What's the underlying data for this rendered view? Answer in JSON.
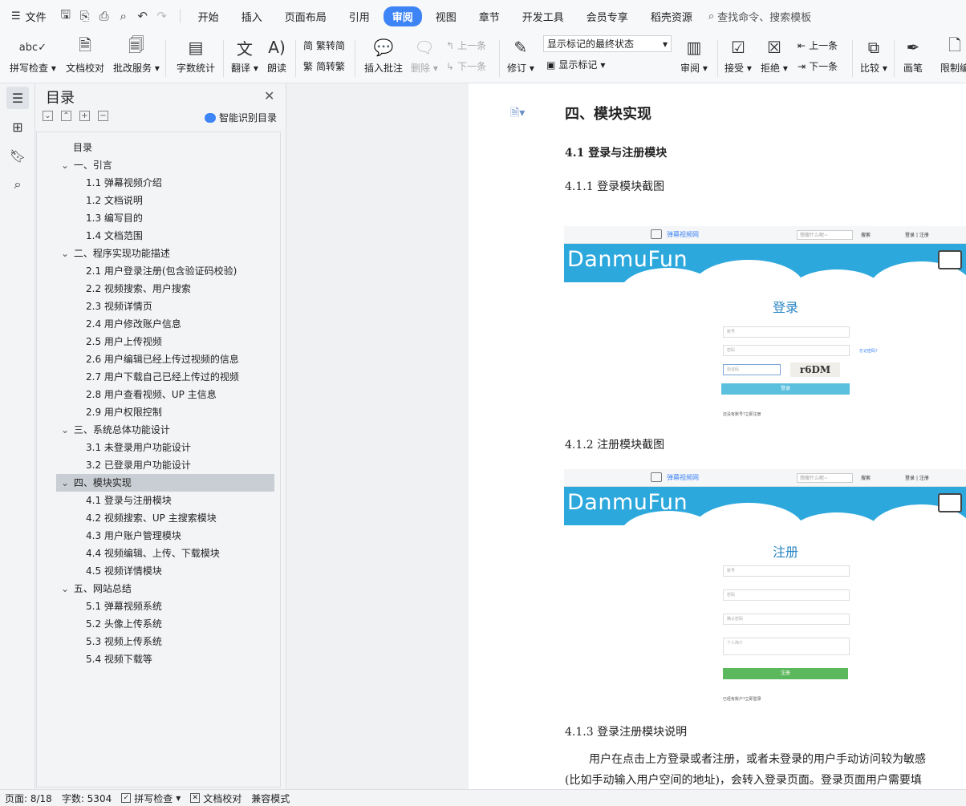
{
  "menubar": {
    "file_label": "文件",
    "tabs": [
      {
        "label": "开始",
        "active": false
      },
      {
        "label": "插入",
        "active": false
      },
      {
        "label": "页面布局",
        "active": false
      },
      {
        "label": "引用",
        "active": false
      },
      {
        "label": "审阅",
        "active": true
      },
      {
        "label": "视图",
        "active": false
      },
      {
        "label": "章节",
        "active": false
      },
      {
        "label": "开发工具",
        "active": false
      },
      {
        "label": "会员专享",
        "active": false
      },
      {
        "label": "稻壳资源",
        "active": false
      }
    ],
    "search_label": "查找命令、搜索模板"
  },
  "ribbon": {
    "spell_check": "拼写检查",
    "doc_check": "文档校对",
    "batch_service": "批改服务",
    "word_count": "字数统计",
    "translate": "翻译",
    "read_aloud": "朗读",
    "trad_to_simp": "繁转简",
    "simp_to_trad": "简转繁",
    "insert_comment": "插入批注",
    "delete": "删除",
    "prev_comment": "上一条",
    "next_comment": "下一条",
    "revise": "修订",
    "markup_state": "显示标记的最终状态",
    "show_markup": "显示标记",
    "review": "审阅",
    "accept": "接受",
    "reject": "拒绝",
    "prev_change": "上一条",
    "next_change": "下一条",
    "compare": "比较",
    "pen": "画笔",
    "restrict": "限制编"
  },
  "toc": {
    "title": "目录",
    "smart_label": "智能识别目录",
    "items": [
      {
        "label": "目录",
        "level": 0,
        "expand": false,
        "selected": false
      },
      {
        "label": "一、引言",
        "level": 1,
        "expand": true,
        "selected": false
      },
      {
        "label": "1.1 弹幕视频介绍",
        "level": 2,
        "expand": false,
        "selected": false
      },
      {
        "label": "1.2 文档说明",
        "level": 2,
        "expand": false,
        "selected": false
      },
      {
        "label": "1.3 编写目的",
        "level": 2,
        "expand": false,
        "selected": false
      },
      {
        "label": "1.4 文档范围",
        "level": 2,
        "expand": false,
        "selected": false
      },
      {
        "label": "二、程序实现功能描述",
        "level": 1,
        "expand": true,
        "selected": false
      },
      {
        "label": "2.1 用户登录注册(包含验证码校验)",
        "level": 2,
        "expand": false,
        "selected": false
      },
      {
        "label": "2.2 视频搜索、用户搜索",
        "level": 2,
        "expand": false,
        "selected": false
      },
      {
        "label": "2.3 视频详情页",
        "level": 2,
        "expand": false,
        "selected": false
      },
      {
        "label": "2.4 用户修改账户信息",
        "level": 2,
        "expand": false,
        "selected": false
      },
      {
        "label": "2.5 用户上传视频",
        "level": 2,
        "expand": false,
        "selected": false
      },
      {
        "label": "2.6 用户编辑已经上传过视频的信息",
        "level": 2,
        "expand": false,
        "selected": false
      },
      {
        "label": "2.7 用户下载自己已经上传过的视频",
        "level": 2,
        "expand": false,
        "selected": false
      },
      {
        "label": "2.8 用户查看视频、UP 主信息",
        "level": 2,
        "expand": false,
        "selected": false
      },
      {
        "label": "2.9 用户权限控制",
        "level": 2,
        "expand": false,
        "selected": false
      },
      {
        "label": "三、系统总体功能设计",
        "level": 1,
        "expand": true,
        "selected": false
      },
      {
        "label": "3.1 未登录用户功能设计",
        "level": 2,
        "expand": false,
        "selected": false
      },
      {
        "label": "3.2 已登录用户功能设计",
        "level": 2,
        "expand": false,
        "selected": false
      },
      {
        "label": "四、模块实现",
        "level": 1,
        "expand": true,
        "selected": true
      },
      {
        "label": "4.1 登录与注册模块",
        "level": 2,
        "expand": false,
        "selected": false
      },
      {
        "label": "4.2 视频搜索、UP 主搜索模块",
        "level": 2,
        "expand": false,
        "selected": false
      },
      {
        "label": "4.3 用户账户管理模块",
        "level": 2,
        "expand": false,
        "selected": false
      },
      {
        "label": "4.4 视频编辑、上传、下载模块",
        "level": 2,
        "expand": false,
        "selected": false
      },
      {
        "label": "4.5 视频详情模块",
        "level": 2,
        "expand": false,
        "selected": false
      },
      {
        "label": "五、网站总结",
        "level": 1,
        "expand": true,
        "selected": false
      },
      {
        "label": "5.1 弹幕视频系统",
        "level": 2,
        "expand": false,
        "selected": false
      },
      {
        "label": "5.2 头像上传系统",
        "level": 2,
        "expand": false,
        "selected": false
      },
      {
        "label": "5.3 视频上传系统",
        "level": 2,
        "expand": false,
        "selected": false
      },
      {
        "label": "5.4 视频下载等",
        "level": 2,
        "expand": false,
        "selected": false
      }
    ]
  },
  "doc": {
    "h1": "四、模块实现",
    "h2": "4.1 登录与注册模块",
    "h3_login": "4.1.1 登录模块截图",
    "h3_register": "4.1.2 注册模块截图",
    "h3_desc": "4.1.3 登录注册模块说明",
    "para_line1": "用户在点击上方登录或者注册，或者未登录的用户手动访问较为敏感",
    "para_line2": "(比如手动输入用户空间的地址)，会转入登录页面。登录页面用户需要填"
  },
  "site": {
    "name": "弹幕视频网",
    "search_placeholder": "想搜什么呢~",
    "search_btn": "搜索",
    "login_link": "登录",
    "sep": "|",
    "register_link": "注册",
    "brand": "DanmuFun",
    "login_title": "登录",
    "register_title": "注册",
    "account_ph": "账号",
    "password_ph": "密码",
    "captcha_ph": "验证码",
    "captcha_text": "r6DM",
    "forgot": "忘记密码?",
    "login_btn": "登录",
    "no_account": "还没有账号?立即注册",
    "confirm_ph": "确认密码",
    "intro_ph": "个人简介",
    "register_btn": "注册",
    "has_account": "已经有账户?立即登录"
  },
  "status": {
    "page": "页面: 8/18",
    "words": "字数: 5304",
    "spell": "拼写检查",
    "doc_check": "文档校对",
    "compat": "兼容模式"
  },
  "colors": {
    "accent": "#3d84f6",
    "banner": "#2da8dd",
    "login_button": "#5bc0de",
    "register_button": "#5cb85c"
  }
}
